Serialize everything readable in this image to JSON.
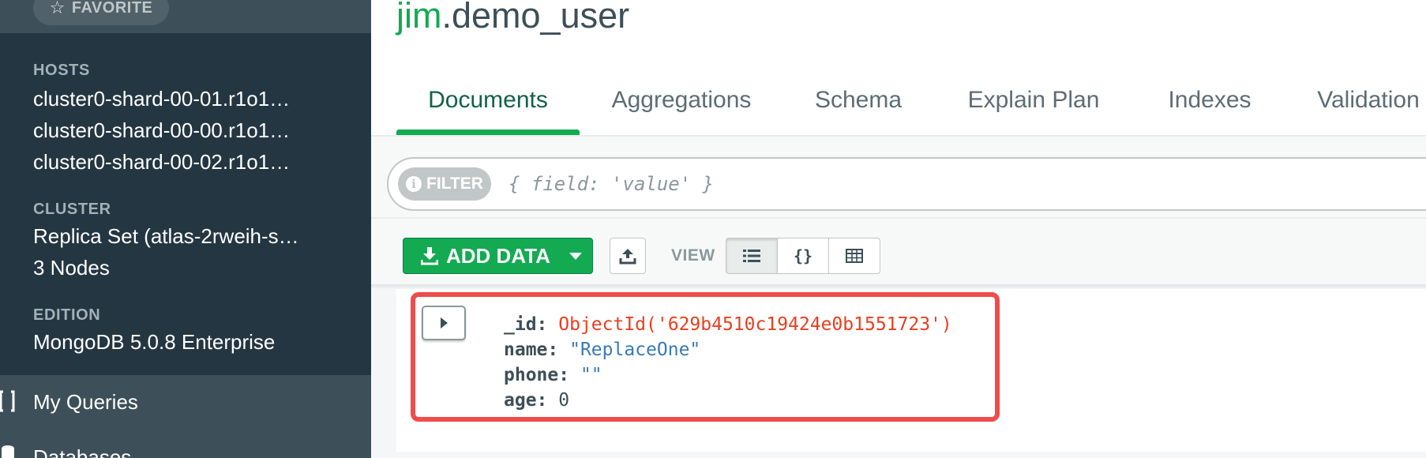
{
  "sidebar": {
    "favorite_label": "FAVORITE",
    "hosts_label": "HOSTS",
    "hosts": [
      "cluster0-shard-00-01.r1o1…",
      "cluster0-shard-00-00.r1o1…",
      "cluster0-shard-00-02.r1o1…"
    ],
    "cluster_label": "CLUSTER",
    "cluster_value": "Replica Set (atlas-2rweih-s…",
    "cluster_nodes": "3 Nodes",
    "edition_label": "EDITION",
    "edition_value": "MongoDB 5.0.8 Enterprise",
    "nav": {
      "my_queries": "My Queries",
      "databases": "Databases"
    }
  },
  "namespace": {
    "db": "jim",
    "collection": ".demo_user"
  },
  "tabs": [
    {
      "label": "Documents",
      "active": true
    },
    {
      "label": "Aggregations",
      "active": false
    },
    {
      "label": "Schema",
      "active": false
    },
    {
      "label": "Explain Plan",
      "active": false
    },
    {
      "label": "Indexes",
      "active": false
    },
    {
      "label": "Validation",
      "active": false
    }
  ],
  "query_bar": {
    "filter_label": "FILTER",
    "filter_info_icon": "i",
    "filter_placeholder": "{ field: 'value' }"
  },
  "toolbar": {
    "add_data_label": "ADD DATA",
    "view_label": "VIEW",
    "view_modes": [
      "list",
      "json",
      "table"
    ],
    "active_view": "list",
    "json_view_glyph": "{}"
  },
  "document": {
    "fields": [
      {
        "key": "_id:",
        "value": "ObjectId('629b4510c19424e0b1551723')",
        "type": "oid"
      },
      {
        "key": "name:",
        "value": "\"ReplaceOne\"",
        "type": "str"
      },
      {
        "key": "phone:",
        "value": "\"\"",
        "type": "str"
      },
      {
        "key": "age:",
        "value": "0",
        "type": "num"
      }
    ]
  },
  "colors": {
    "accent": "#13aa52",
    "sidebar": "#243642",
    "highlight": "#ef4c4c",
    "oid": "#ec3e1e",
    "string": "#3979b9"
  }
}
